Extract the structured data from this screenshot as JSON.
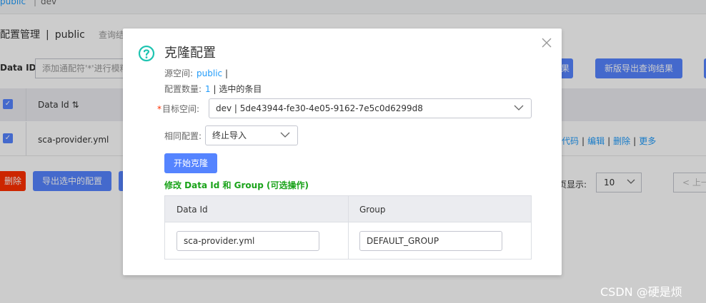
{
  "topbar": {
    "ns_public": "public",
    "ns_sep": "|",
    "ns_dev": "dev"
  },
  "page": {
    "title": "配置管理",
    "title_sep": "|",
    "namespace": "public",
    "hint": "查询结"
  },
  "search": {
    "label": "Data ID:",
    "placeholder": "添加通配符'*'进行模糊"
  },
  "toolbar": {
    "query_btn": "果",
    "new_export_btn": "新版导出查询结果"
  },
  "table": {
    "header_dataid": "Data Id",
    "sort_icon": "⇅",
    "row_dataid": "sca-provider.yml",
    "actions": [
      "代码",
      "编辑",
      "删除",
      "更多"
    ],
    "pipe": "|"
  },
  "bottom": {
    "delete_btn": "删除",
    "export_selected_btn": "导出选中的配置",
    "page_size_label": "页显示:",
    "page_size_value": "10",
    "prev_page": "< 上一"
  },
  "dialog": {
    "title": "克隆配置",
    "source_ns_label": "源空间:",
    "source_ns_value": "public",
    "source_ns_suffix": "|",
    "count_label": "配置数量:",
    "count_value": "1",
    "count_suffix": "| 选中的条目",
    "required_mark": "*",
    "target_label": "目标空间:",
    "target_value": "dev | 5de43944-fe30-4e05-9162-7e5c0d6299d8",
    "same_label": "相同配置:",
    "same_value": "终止导入",
    "start_btn": "开始克隆",
    "modify_title": "修改 Data Id 和 Group (可选操作)",
    "col_dataid": "Data Id",
    "col_group": "Group",
    "row_dataid": "sca-provider.yml",
    "row_group": "DEFAULT_GROUP"
  },
  "watermark": "CSDN @硬是烦",
  "colors": {
    "primary": "#5584ff",
    "link": "#209bfa",
    "danger": "#ff3000",
    "success": "#1aa31a",
    "help_icon": "#1fc4b1"
  }
}
